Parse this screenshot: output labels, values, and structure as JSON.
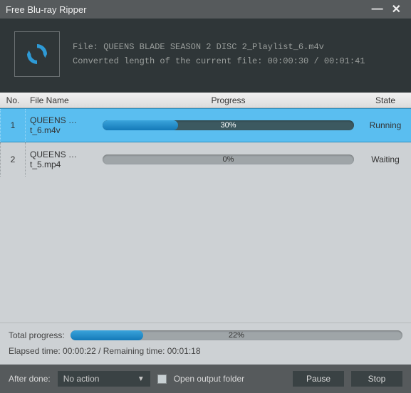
{
  "title": "Free Blu-ray Ripper",
  "header": {
    "file_line": "File: QUEENS BLADE SEASON 2 DISC 2_Playlist_6.m4v",
    "converted_line": "Converted length of the current file: 00:00:30 / 00:01:41"
  },
  "columns": {
    "no": "No.",
    "file": "File Name",
    "progress": "Progress",
    "state": "State"
  },
  "rows": [
    {
      "no": "1",
      "file": "QUEENS …t_6.m4v",
      "progress_pct": 30,
      "progress_label": "30%",
      "state": "Running",
      "selected": true
    },
    {
      "no": "2",
      "file": "QUEENS …t_5.mp4",
      "progress_pct": 0,
      "progress_label": "0%",
      "state": "Waiting",
      "selected": false
    }
  ],
  "total": {
    "label": "Total progress:",
    "pct": 22,
    "pct_label": "22%",
    "time_line": "Elapsed time: 00:00:22 / Remaining time: 00:01:18"
  },
  "footer": {
    "after_done_label": "After done:",
    "after_done_value": "No action",
    "open_output_label": "Open output folder",
    "pause": "Pause",
    "stop": "Stop"
  }
}
